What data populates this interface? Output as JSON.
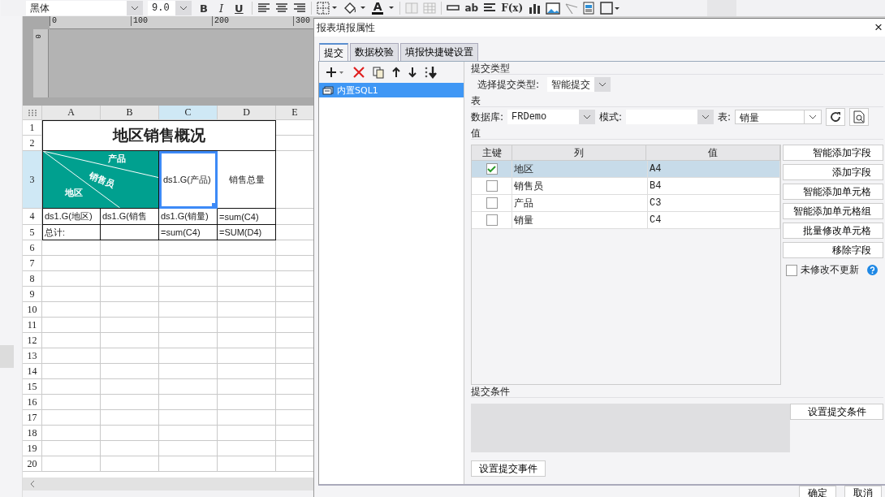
{
  "toolbar": {
    "font": "黑体",
    "font_size": "9.0",
    "format_buttons": [
      {
        "label": "B",
        "kind": "bold"
      },
      {
        "label": "I",
        "kind": "italic"
      },
      {
        "label": "U",
        "kind": "underline"
      }
    ],
    "font_color_label": "A",
    "text_tools": [
      "ab",
      "F(x)"
    ]
  },
  "ruler": {
    "ticks": [
      "0",
      "100",
      "200",
      "300"
    ],
    "side_tick": "0"
  },
  "sheet": {
    "columns": [
      {
        "label": "A",
        "selected": false
      },
      {
        "label": "B",
        "selected": false
      },
      {
        "label": "C",
        "selected": true
      },
      {
        "label": "D",
        "selected": false
      },
      {
        "label": "E",
        "selected": false
      }
    ],
    "rows": [
      {
        "label": "1",
        "selected": false
      },
      {
        "label": "2",
        "selected": false
      },
      {
        "label": "3",
        "selected": true
      },
      {
        "label": "4",
        "selected": false
      },
      {
        "label": "5",
        "selected": false
      },
      {
        "label": "6",
        "selected": false
      },
      {
        "label": "7",
        "selected": false
      },
      {
        "label": "8",
        "selected": false
      },
      {
        "label": "9",
        "selected": false
      },
      {
        "label": "10",
        "selected": false
      },
      {
        "label": "11",
        "selected": false
      },
      {
        "label": "12",
        "selected": false
      },
      {
        "label": "13",
        "selected": false
      },
      {
        "label": "14",
        "selected": false
      },
      {
        "label": "15",
        "selected": false
      },
      {
        "label": "16",
        "selected": false
      },
      {
        "label": "17",
        "selected": false
      },
      {
        "label": "18",
        "selected": false
      },
      {
        "label": "19",
        "selected": false
      },
      {
        "label": "20",
        "selected": false
      }
    ],
    "cells": [
      {
        "kind": "title",
        "text": "地区销售概况",
        "selected": false
      },
      {
        "kind": "diagonal",
        "labels": [
          "产品",
          "销售员",
          "地区"
        ],
        "selected": false
      },
      {
        "kind": "text",
        "text": "ds1.G(产品)",
        "selected": true
      },
      {
        "kind": "header",
        "text": "销售总量",
        "selected": false
      },
      {
        "kind": "text",
        "text": "ds1.G(地区)",
        "selected": false
      },
      {
        "kind": "text",
        "text": "ds1.G(销售",
        "selected": false
      },
      {
        "kind": "text",
        "text": "ds1.G(销量)",
        "selected": false
      },
      {
        "kind": "text",
        "text": "=sum(C4)",
        "selected": false
      },
      {
        "kind": "text",
        "text": "总计:",
        "selected": false
      },
      {
        "kind": "text",
        "selected": false
      },
      {
        "kind": "text",
        "text": "=sum(C4)",
        "selected": false
      },
      {
        "kind": "text",
        "text": "=SUM(D4)",
        "selected": false
      }
    ]
  },
  "dialog": {
    "title": "报表填报属性",
    "close": "×",
    "tabs": [
      {
        "label": "提交",
        "selected": true
      },
      {
        "label": "数据校验",
        "selected": false
      },
      {
        "label": "填报快捷键设置",
        "selected": false
      }
    ],
    "list": [
      {
        "label": "内置SQL1",
        "selected": true
      }
    ],
    "submit_type": {
      "section": "提交类型",
      "label": "选择提交类型:",
      "value": "智能提交"
    },
    "table": {
      "section": "表",
      "database_label": "数据库:",
      "database": "FRDemo",
      "schema_label": "模式:",
      "table_label": "表:",
      "table": "销量"
    },
    "values": {
      "section": "值",
      "columns": [
        "主键",
        "列",
        "值"
      ],
      "rows": [
        {
          "key": true,
          "column": "地区",
          "value": "A4",
          "selected": true
        },
        {
          "key": false,
          "column": "销售员",
          "value": "B4",
          "selected": false
        },
        {
          "key": false,
          "column": "产品",
          "value": "C3",
          "selected": false
        },
        {
          "key": false,
          "column": "销量",
          "value": "C4",
          "selected": false
        }
      ],
      "buttons": [
        "智能添加字段",
        "添加字段",
        "智能添加单元格",
        "智能添加单元格组",
        "批量修改单元格",
        "移除字段"
      ],
      "skip_unchanged": {
        "label": "未修改不更新",
        "checked": false
      }
    },
    "condition": {
      "section": "提交条件",
      "button": "设置提交条件"
    },
    "event_button": "设置提交事件",
    "footer_buttons": [
      "确定",
      "取消"
    ]
  }
}
